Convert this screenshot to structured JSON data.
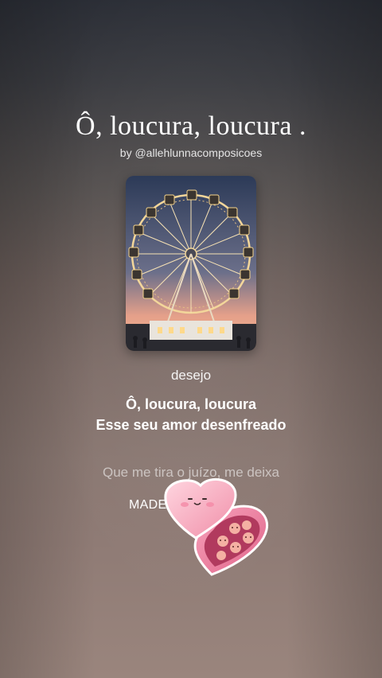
{
  "song": {
    "title": "Ô,  loucura, loucura .",
    "byline": "by @allehlunnacomposicoes"
  },
  "cover": {
    "image": "ferris-wheel-at-dusk"
  },
  "lyrics": {
    "section_label": "desejo",
    "highlighted": [
      "Ô, loucura, loucura",
      "Esse seu amor desenfreado"
    ],
    "next_line": "Que me tira o juízo, me deixa",
    "partial_line": "MADE"
  },
  "sticker": {
    "icon": "heart-chocolate-box-sticker"
  },
  "colors": {
    "text": "#ffffff",
    "sticker_pink": "#f4a7b9",
    "sticker_dark": "#b13a5e"
  }
}
